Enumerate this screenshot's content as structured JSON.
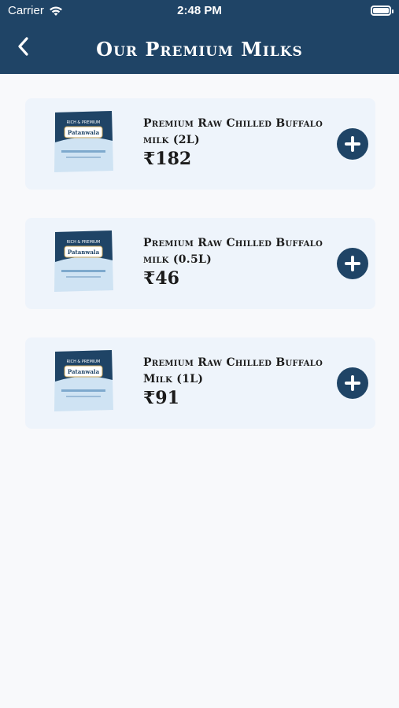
{
  "status_bar": {
    "carrier": "Carrier",
    "time": "2:48 PM"
  },
  "header": {
    "title": "Our Premium Milks"
  },
  "products": [
    {
      "name": "Premium Raw Chilled Buffalo milk (2L)",
      "price": "₹182",
      "pack_label": "RICH & PREMIUM",
      "pack_brand": "Patanwala"
    },
    {
      "name": "Premium Raw Chilled Buffalo milk (0.5L)",
      "price": "₹46",
      "pack_label": "RICH & PREMIUM",
      "pack_brand": "Patanwala"
    },
    {
      "name": "Premium Raw Chilled Buffalo Milk (1L)",
      "price": "₹91",
      "pack_label": "RICH & PREMIUM",
      "pack_brand": "Patanwala"
    }
  ],
  "colors": {
    "header": "#1f4466",
    "card": "#eef4fb",
    "background": "#f8f9fb",
    "add_button": "#1f4466"
  },
  "icons": {
    "back": "chevron-left-icon",
    "add": "plus-icon",
    "wifi": "wifi-icon",
    "battery": "battery-icon"
  }
}
